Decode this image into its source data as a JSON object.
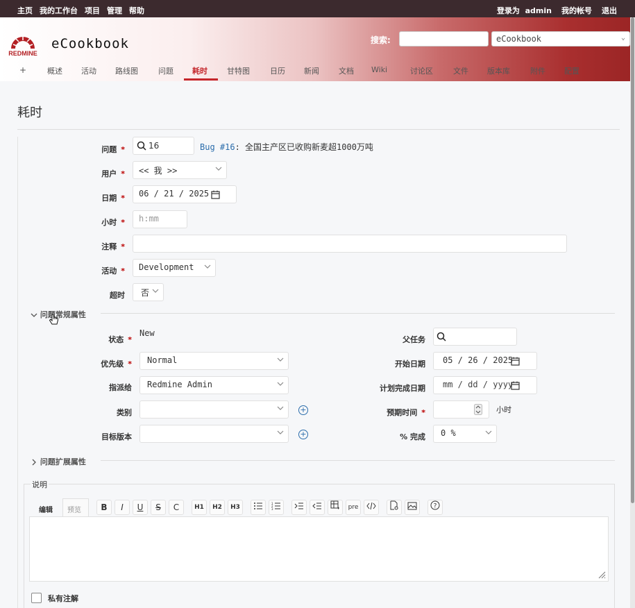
{
  "top_menu": {
    "home": "主页",
    "my_page": "我的工作台",
    "projects": "项目",
    "admin": "管理",
    "help": "帮助",
    "logged_in_as": "登录为",
    "user": "admin",
    "my_account": "我的帐号",
    "logout": "退出"
  },
  "header": {
    "project_title": "eCookbook",
    "logo_text": "REDMINE",
    "search_label": "搜索:",
    "search_placeholder": "",
    "project_jump": "eCookbook"
  },
  "main_menu": {
    "plus": "+",
    "tabs": [
      "概述",
      "活动",
      "路线图",
      "问题",
      "耗时",
      "甘特图",
      "日历",
      "新闻",
      "文档",
      "Wiki",
      "讨论区",
      "文件",
      "版本库",
      "附件",
      "配置"
    ],
    "selected": "耗时"
  },
  "page_title": "耗时",
  "form": {
    "issue_label": "问题",
    "issue_value": "16",
    "issue_link": "Bug #16",
    "issue_subject": ": 全国主产区已收购新麦超1000万吨",
    "user_label": "用户",
    "user_value": "<< 我 >>",
    "date_label": "日期",
    "date_value": "06 / 21 / 2025",
    "hours_label": "小时",
    "hours_placeholder": "h:mm",
    "comments_label": "注释",
    "activity_label": "活动",
    "activity_value": "Development",
    "overtime_label": "超时",
    "overtime_value": "否",
    "required_mark": "*"
  },
  "issue_attributes": {
    "toggle_label": "问题常规属性",
    "status_label": "状态",
    "status_value": "New",
    "priority_label": "优先级",
    "priority_value": "Normal",
    "assignee_label": "指派给",
    "assignee_value": "Redmine Admin",
    "category_label": "类别",
    "category_value": "",
    "version_label": "目标版本",
    "version_value": "",
    "parent_label": "父任务",
    "start_label": "开始日期",
    "start_value": "05 / 26 / 2025",
    "due_label": "计划完成日期",
    "due_placeholder": "mm / dd / yyyy",
    "estimated_label": "预期时间",
    "estimated_unit": "小时",
    "done_label": "% 完成",
    "done_value": "0 %"
  },
  "extended_attributes": {
    "toggle_label": "问题扩展属性"
  },
  "description": {
    "legend": "说明",
    "tab_edit": "编辑",
    "tab_preview": "预览",
    "toolbar": [
      "B",
      "I",
      "U",
      "S",
      "C",
      "H1",
      "H2",
      "H3",
      "ul",
      "ol",
      "indent",
      "outdent",
      "table",
      "pre",
      "code",
      "link",
      "image",
      "help"
    ],
    "pre_label": "pre"
  },
  "private_notes_label": "私有注解"
}
